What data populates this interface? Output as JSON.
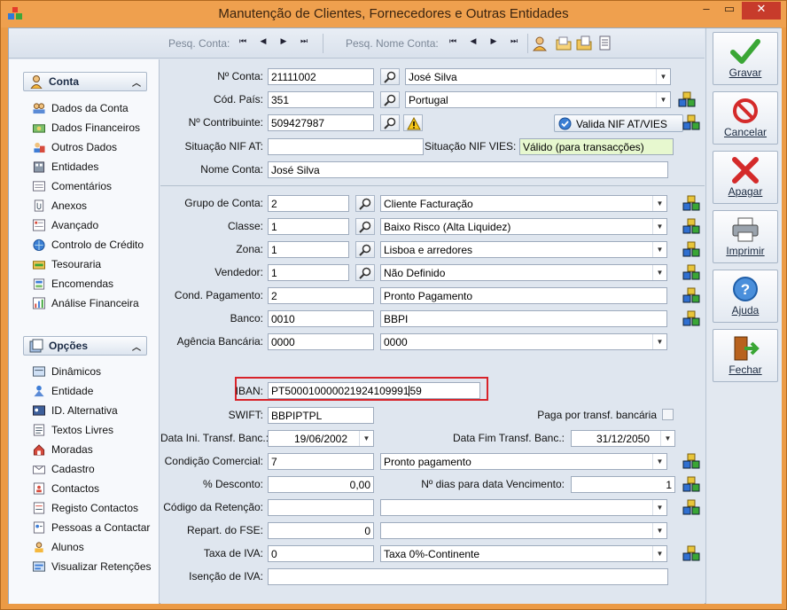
{
  "window": {
    "title": "Manutenção de Clientes, Fornecedores e Outras Entidades",
    "minimize": "–",
    "maximize": "▭",
    "close": "✕"
  },
  "toolbar": {
    "search_account_label": "Pesq. Conta:",
    "search_name_label": "Pesq. Nome Conta:",
    "first": "⏮",
    "prev": "◀",
    "next": "▶",
    "last": "⏭"
  },
  "sidebar": {
    "account_header": "Conta",
    "account_items": [
      {
        "label": "Dados da Conta",
        "icon": "users-icon"
      },
      {
        "label": "Dados Financeiros",
        "icon": "money-icon"
      },
      {
        "label": "Outros Dados",
        "icon": "people-icon"
      },
      {
        "label": "Entidades",
        "icon": "building-icon"
      },
      {
        "label": "Comentários",
        "icon": "notes-icon"
      },
      {
        "label": "Anexos",
        "icon": "attachment-icon"
      },
      {
        "label": "Avançado",
        "icon": "list-icon"
      },
      {
        "label": "Controlo de Crédito",
        "icon": "globe-icon"
      },
      {
        "label": "Tesouraria",
        "icon": "treasury-icon"
      },
      {
        "label": "Encomendas",
        "icon": "orders-icon"
      },
      {
        "label": "Análise Financeira",
        "icon": "chart-icon"
      }
    ],
    "options_header": "Opções",
    "option_items": [
      {
        "label": "Dinâmicos",
        "icon": "dynamic-icon"
      },
      {
        "label": "Entidade",
        "icon": "entity-icon"
      },
      {
        "label": "ID. Alternativa",
        "icon": "id-icon"
      },
      {
        "label": "Textos Livres",
        "icon": "text-icon"
      },
      {
        "label": "Moradas",
        "icon": "address-icon"
      },
      {
        "label": "Cadastro",
        "icon": "register-icon"
      },
      {
        "label": "Contactos",
        "icon": "contacts-icon"
      },
      {
        "label": "Registo Contactos",
        "icon": "contact-log-icon"
      },
      {
        "label": "Pessoas a Contactar",
        "icon": "persons-icon"
      },
      {
        "label": "Alunos",
        "icon": "students-icon"
      },
      {
        "label": "Visualizar Retenções",
        "icon": "retention-icon"
      }
    ]
  },
  "form": {
    "account": {
      "label": "Nº Conta:",
      "value": "21111002",
      "name": "José Silva"
    },
    "country": {
      "label": "Cód. País:",
      "value": "351",
      "name": "Portugal"
    },
    "taxpayer": {
      "label": "Nº Contribuinte:",
      "value": "509427987",
      "validate_button": "Valida NIF AT/VIES"
    },
    "nif_status": {
      "label": "Situação NIF AT:",
      "value": "",
      "vies_label": "Situação NIF VIES:",
      "vies_value": "Válido (para transacções)"
    },
    "account_name": {
      "label": "Nome Conta:",
      "value": "José Silva"
    },
    "account_group": {
      "label": "Grupo de Conta:",
      "value": "2",
      "desc": "Cliente Facturação"
    },
    "class": {
      "label": "Classe:",
      "value": "1",
      "desc": "Baixo Risco (Alta Liquidez)"
    },
    "zone": {
      "label": "Zona:",
      "value": "1",
      "desc": "Lisboa e arredores"
    },
    "seller": {
      "label": "Vendedor:",
      "value": "1",
      "desc": "Não Definido"
    },
    "payment_cond": {
      "label": "Cond. Pagamento:",
      "value": "2",
      "desc": "Pronto Pagamento"
    },
    "bank": {
      "label": "Banco:",
      "value": "0010",
      "desc": "BBPI"
    },
    "bank_agency": {
      "label": "Agência Bancária:",
      "value": "0000",
      "desc": "0000"
    },
    "iban": {
      "label": "IBAN:",
      "value_before_cursor": "PT500010000021924109991",
      "value_after_cursor": "59"
    },
    "swift": {
      "label": "SWIFT:",
      "value": "BBPIPTPL",
      "transfer_label": "Paga por transf. bancária",
      "transfer_checked": false
    },
    "transfer_start": {
      "label": "Data Ini. Transf. Banc.:",
      "value": "19/06/2002",
      "end_label": "Data Fim Transf. Banc.:",
      "end_value": "31/12/2050"
    },
    "commercial_cond": {
      "label": "Condição Comercial:",
      "value": "7",
      "desc": "Pronto pagamento"
    },
    "discount": {
      "label": "% Desconto:",
      "value": "0,00",
      "due_days_label": "Nº dias para data Vencimento:",
      "due_days_value": "1"
    },
    "retention": {
      "label": "Código da Retenção:",
      "value": "",
      "desc": ""
    },
    "fse": {
      "label": "Repart. do FSE:",
      "value": "0",
      "desc": ""
    },
    "vat_rate": {
      "label": "Taxa de IVA:",
      "value": "0",
      "desc": "Taxa  0%-Continente"
    },
    "vat_exemption": {
      "label": "Isenção de IVA:",
      "value": ""
    }
  },
  "actions": {
    "save": "Gravar",
    "cancel": "Cancelar",
    "delete": "Apagar",
    "print": "Imprimir",
    "help": "Ajuda",
    "close": "Fechar"
  },
  "colors": {
    "window_frame": "#eb9a45",
    "client_bg": "#dfe6ef",
    "highlight_border": "#d8232a",
    "valid_bg": "#e7f8cf",
    "save_green": "#3aa635",
    "cancel_red": "#d42a2a"
  }
}
